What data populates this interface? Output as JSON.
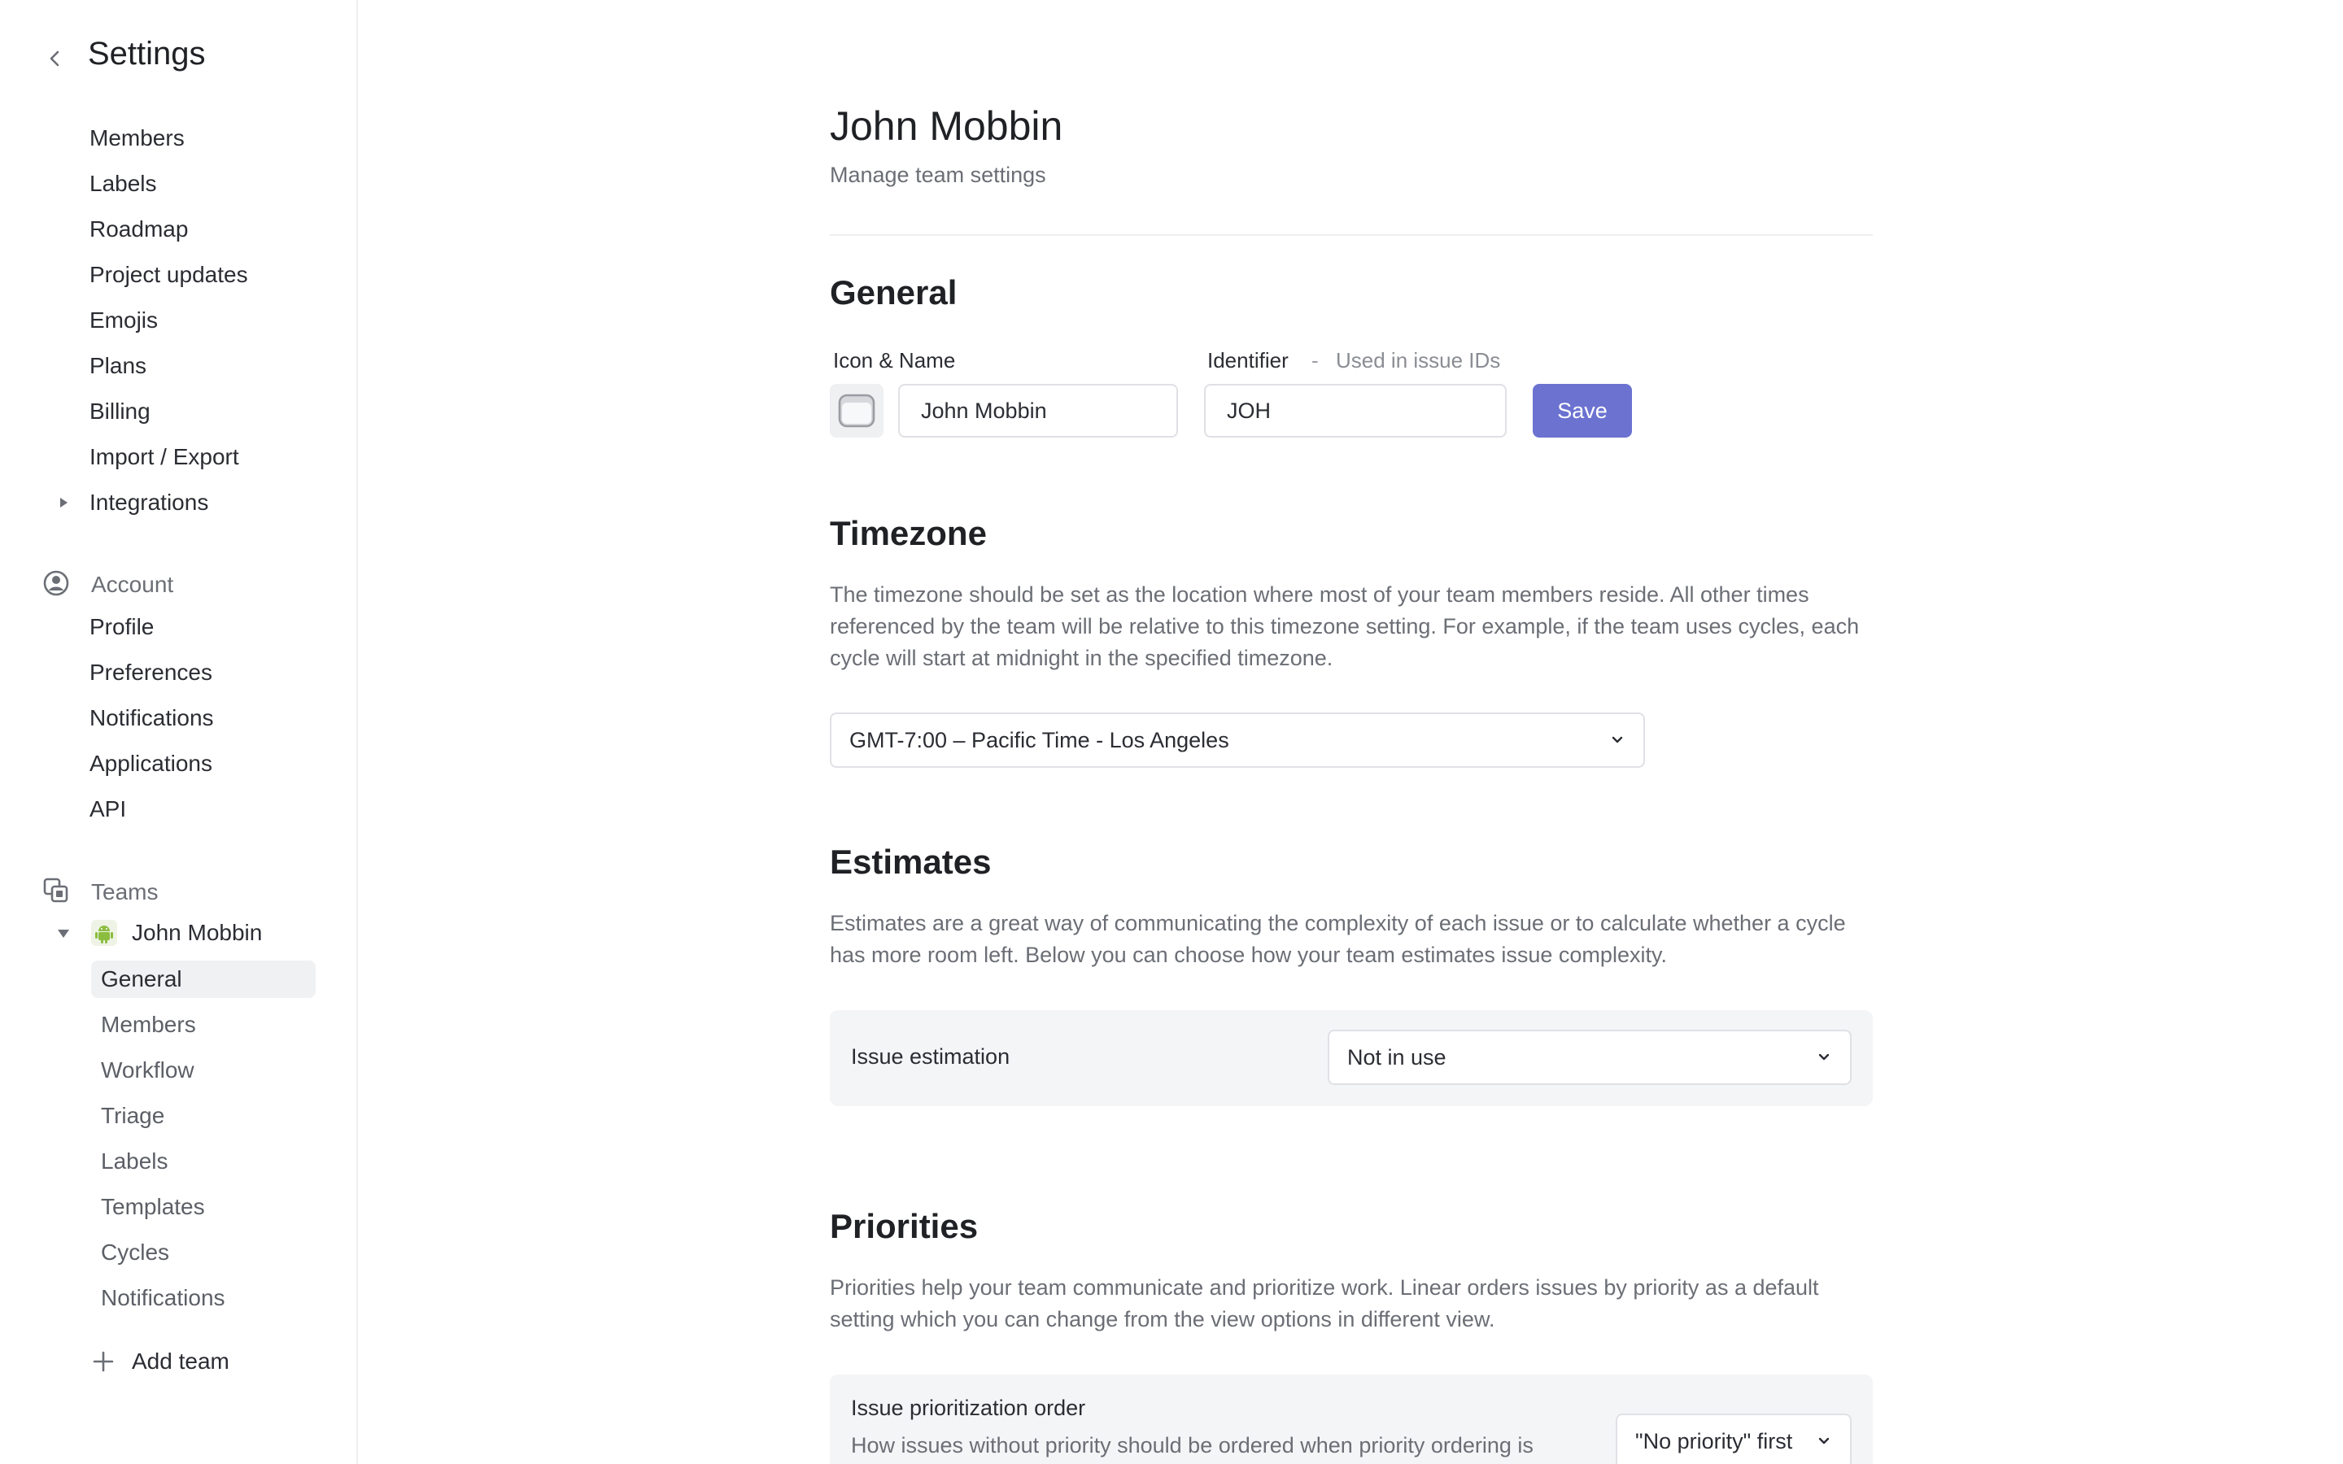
{
  "sidebar": {
    "title": "Settings",
    "workspace_items": [
      "Members",
      "Labels",
      "Roadmap",
      "Project updates",
      "Emojis",
      "Plans",
      "Billing",
      "Import / Export",
      "Integrations"
    ],
    "account": {
      "heading": "Account",
      "items": [
        "Profile",
        "Preferences",
        "Notifications",
        "Applications",
        "API"
      ]
    },
    "teams": {
      "heading": "Teams",
      "team_name": "John Mobbin",
      "items": [
        "General",
        "Members",
        "Workflow",
        "Triage",
        "Labels",
        "Templates",
        "Cycles",
        "Notifications"
      ],
      "active_item": "General",
      "add_team_label": "Add team"
    }
  },
  "main": {
    "title": "John Mobbin",
    "subtitle": "Manage team settings",
    "general": {
      "heading": "General",
      "icon_name_label": "Icon & Name",
      "identifier_label": "Identifier",
      "identifier_dash": "-",
      "identifier_hint": "Used in issue IDs",
      "name_value": "John Mobbin",
      "identifier_value": "JOH",
      "save_label": "Save"
    },
    "timezone": {
      "heading": "Timezone",
      "description": "The timezone should be set as the location where most of your team members reside. All other times referenced by the team will be relative to this timezone setting. For example, if the team uses cycles, each cycle will start at midnight in the specified timezone.",
      "selected": "GMT-7:00 – Pacific Time - Los Angeles"
    },
    "estimates": {
      "heading": "Estimates",
      "description": "Estimates are a great way of communicating the complexity of each issue or to calculate whether a cycle has more room left. Below you can choose how your team estimates issue complexity.",
      "row_label": "Issue estimation",
      "selected": "Not in use"
    },
    "priorities": {
      "heading": "Priorities",
      "description": "Priorities help your team communicate and prioritize work. Linear orders issues by priority as a default setting which you can change from the view options in different view.",
      "row_label": "Issue prioritization order",
      "row_desc": "How issues without priority should be ordered when priority ordering is",
      "selected": "\"No priority\" first"
    }
  },
  "colors": {
    "accent": "#6b72d0",
    "active_bg": "#f0f1f3",
    "card_bg": "#f4f5f7",
    "border": "#e0e1e5"
  }
}
